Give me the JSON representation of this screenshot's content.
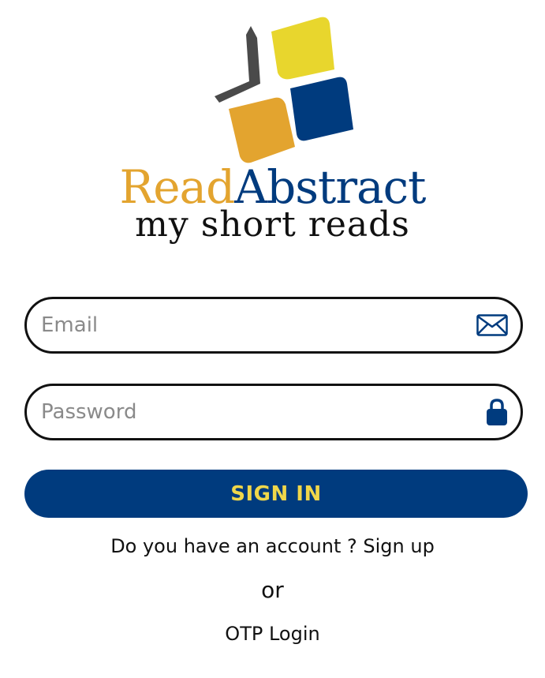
{
  "brand": {
    "name_part1": "Read",
    "name_part2": "Abstract",
    "tagline": "my short reads",
    "colors": {
      "gold": "#e3a42f",
      "yellow": "#e8d62d",
      "navy": "#003b7e",
      "gray": "#4a4a4a"
    }
  },
  "form": {
    "email": {
      "placeholder": "Email",
      "value": "",
      "icon": "mail-icon"
    },
    "password": {
      "placeholder": "Password",
      "value": "",
      "icon": "lock-icon"
    },
    "signin_label": "SIGN IN"
  },
  "footer": {
    "account_question": "Do you have an account ? ",
    "signup_label": "Sign up",
    "or_label": "or",
    "otp_label": "OTP Login"
  },
  "colors": {
    "primary": "#003b7e",
    "button_text": "#f0d74a",
    "border": "#111111",
    "placeholder": "#8a8a8a"
  }
}
